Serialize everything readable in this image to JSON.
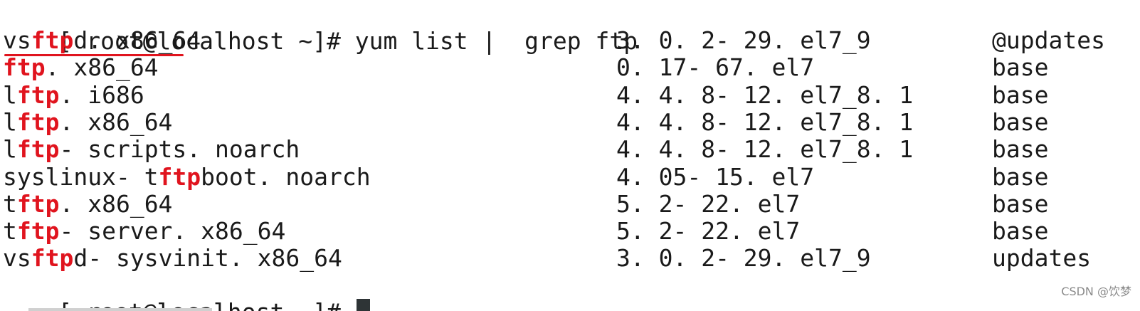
{
  "terminal": {
    "prompt": "[ root@localhost ~]# ",
    "command": "yum list |  grep ftp",
    "highlight_color": "#e0141e",
    "rows": [
      {
        "pre": "vs",
        "hl": "ftp",
        "post": "d. x86_64",
        "version": "3. 0. 2- 29. el7_9",
        "repo": "@updates"
      },
      {
        "pre": "",
        "hl": "ftp",
        "post": ". x86_64",
        "version": "0. 17- 67. el7",
        "repo": "base"
      },
      {
        "pre": "l",
        "hl": "ftp",
        "post": ". i686",
        "version": "4. 4. 8- 12. el7_8. 1",
        "repo": "base"
      },
      {
        "pre": "l",
        "hl": "ftp",
        "post": ". x86_64",
        "version": "4. 4. 8- 12. el7_8. 1",
        "repo": "base"
      },
      {
        "pre": "l",
        "hl": "ftp",
        "post": "- scripts. noarch",
        "version": "4. 4. 8- 12. el7_8. 1",
        "repo": "base"
      },
      {
        "pre": "syslinux- t",
        "hl": "ftp",
        "post": "boot. noarch",
        "version": "4. 05- 15. el7",
        "repo": "base"
      },
      {
        "pre": "t",
        "hl": "ftp",
        "post": ". x86_64",
        "version": "5. 2- 22. el7",
        "repo": "base"
      },
      {
        "pre": "t",
        "hl": "ftp",
        "post": "- server. x86_64",
        "version": "5. 2- 22. el7",
        "repo": "base"
      },
      {
        "pre": "vs",
        "hl": "ftp",
        "post": "d- sysvinit. x86_64",
        "version": "3. 0. 2- 29. el7_9",
        "repo": "updates"
      }
    ],
    "final_prompt": "[ root@localhost ~]# "
  },
  "watermark": "CSDN @饮梦"
}
